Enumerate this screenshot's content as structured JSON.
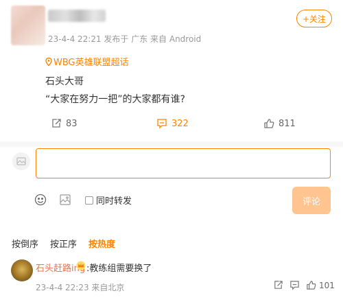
{
  "post": {
    "meta": "23-4-4 22:21 发布于 广东 来自 Android",
    "follow_label": "+关注",
    "topic": "WBG英雄联盟超话",
    "line1": "石头大哥",
    "line2": "“大家在努力一把”的大家都有谁?",
    "repost_count": "83",
    "comment_count": "322",
    "like_count": "811"
  },
  "reply": {
    "placeholder": "",
    "repost_label": "同时转发",
    "submit_label": "评论"
  },
  "sort": {
    "options": [
      "按倒序",
      "按正序",
      "按热度"
    ],
    "active": "按热度"
  },
  "comment": {
    "user": "石头赶路ing",
    "text": ":教练组需要换了",
    "meta": "23-4-4 22:23 来自北京",
    "like_count": "101"
  },
  "colors": {
    "accent": "#ff8200",
    "submit_disabled": "#ffc48f",
    "muted": "#999999"
  },
  "icons": [
    "location-pin-icon",
    "repost-icon",
    "comment-icon",
    "like-icon",
    "emoji-icon",
    "image-icon",
    "crown-icon",
    "avatar-placeholder-icon"
  ]
}
